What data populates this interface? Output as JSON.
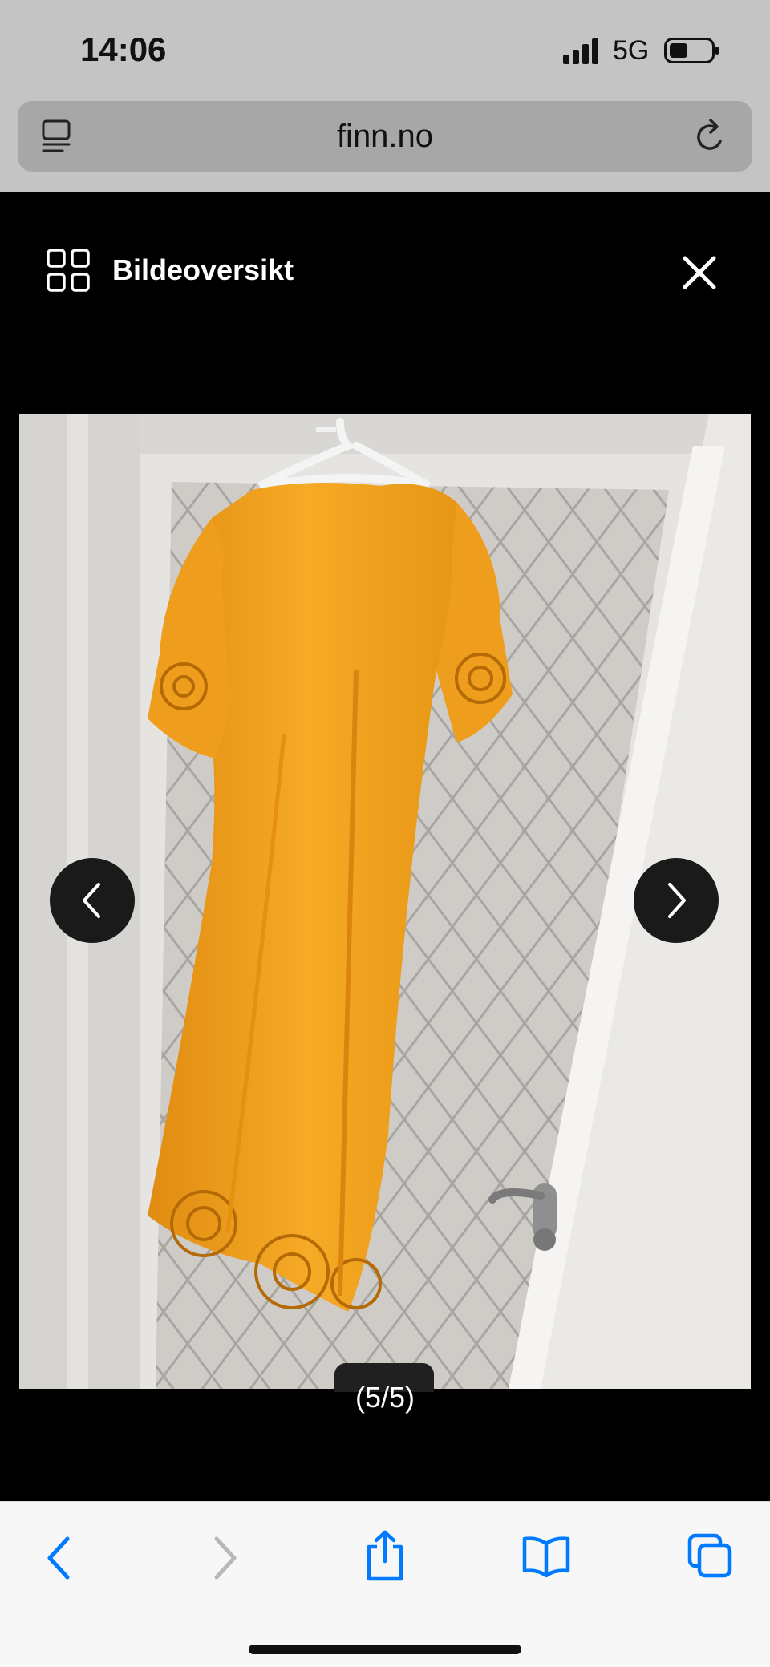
{
  "status_bar": {
    "time": "14:06",
    "network": "5G"
  },
  "browser": {
    "url": "finn.no"
  },
  "viewer": {
    "title": "Bildeoversikt",
    "counter": "(5/5)"
  },
  "colors": {
    "accent": "#007aff",
    "dress": "#f2a31f"
  },
  "icons": [
    "signal-icon",
    "battery-icon",
    "tabs-overview-icon",
    "reload-icon",
    "grid-icon",
    "close-icon",
    "chevron-left-icon",
    "chevron-right-icon",
    "back-icon",
    "forward-icon",
    "share-icon",
    "bookmarks-icon",
    "tabs-icon"
  ]
}
